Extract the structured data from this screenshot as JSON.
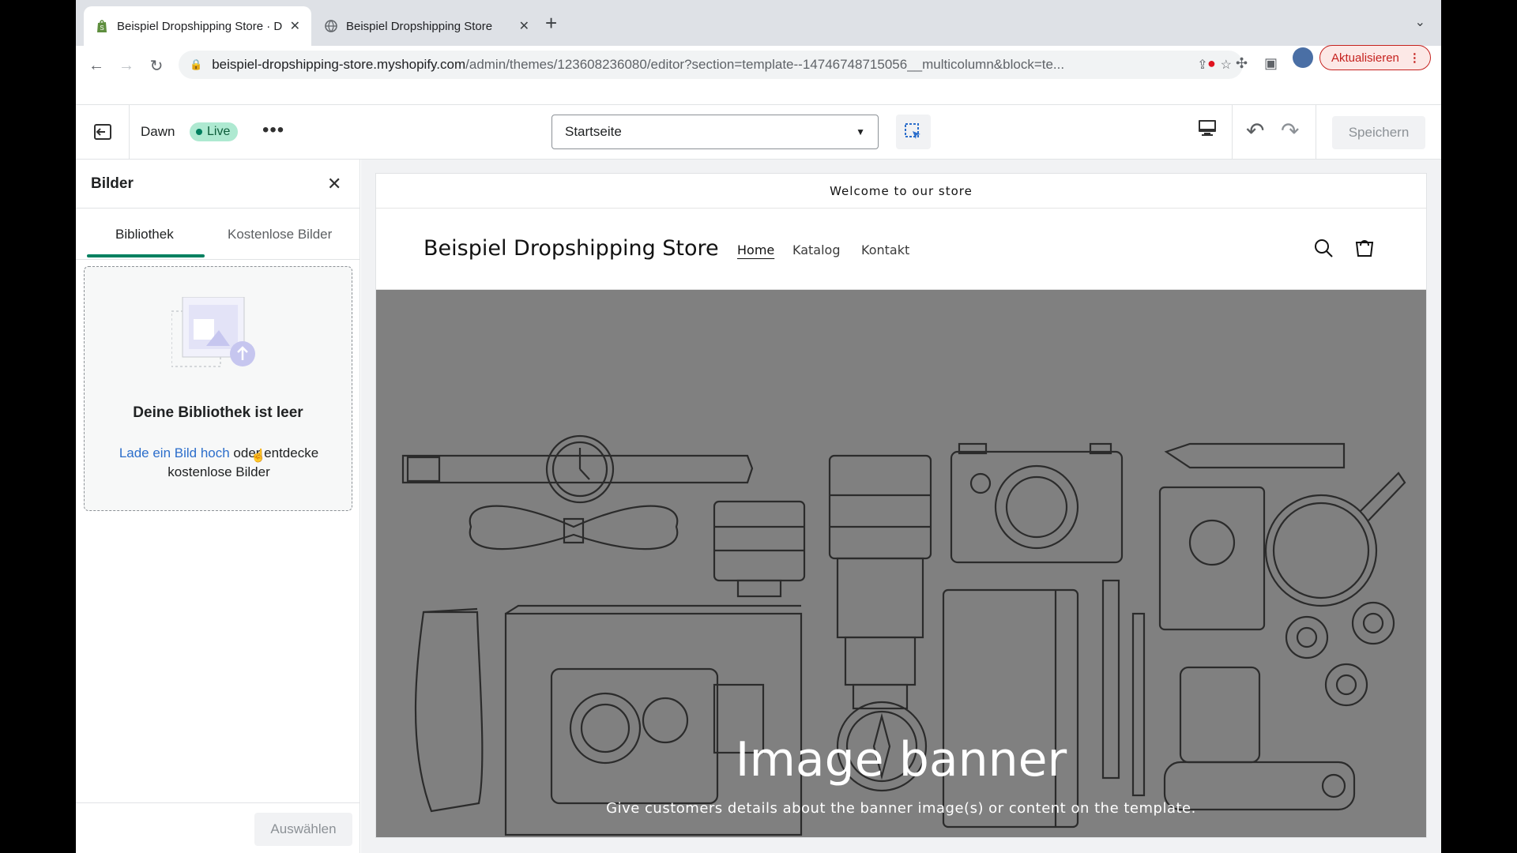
{
  "browser": {
    "tabs": [
      {
        "title": "Beispiel Dropshipping Store · D",
        "active": true
      },
      {
        "title": "Beispiel Dropshipping Store",
        "active": false
      }
    ],
    "url_host": "beispiel-dropshipping-store.myshopify.com",
    "url_path": "/admin/themes/123608236080/editor?section=template--14746748715056__multicolumn&block=te...",
    "update_label": "Aktualisieren"
  },
  "editor": {
    "theme_name": "Dawn",
    "live_label": "Live",
    "page_select": "Startseite",
    "save_label": "Speichern"
  },
  "panel": {
    "title": "Bilder",
    "tabs": [
      "Bibliothek",
      "Kostenlose Bilder"
    ],
    "empty_title": "Deine Bibliothek ist leer",
    "upload_link": "Lade ein Bild hoch",
    "upload_rest": " oder entdecke kostenlose Bilder",
    "select_label": "Auswählen"
  },
  "store": {
    "announcement": "Welcome to our store",
    "name": "Beispiel Dropshipping Store",
    "nav": [
      "Home",
      "Katalog",
      "Kontakt"
    ],
    "banner_title": "Image banner",
    "banner_subtitle": "Give customers details about the banner image(s) or content on the template."
  },
  "colors": {
    "accent": "#008060",
    "live_badge": "#aee9d1",
    "link": "#2c6ecb",
    "banner_bg": "#808080",
    "update_red": "#c5221f"
  }
}
